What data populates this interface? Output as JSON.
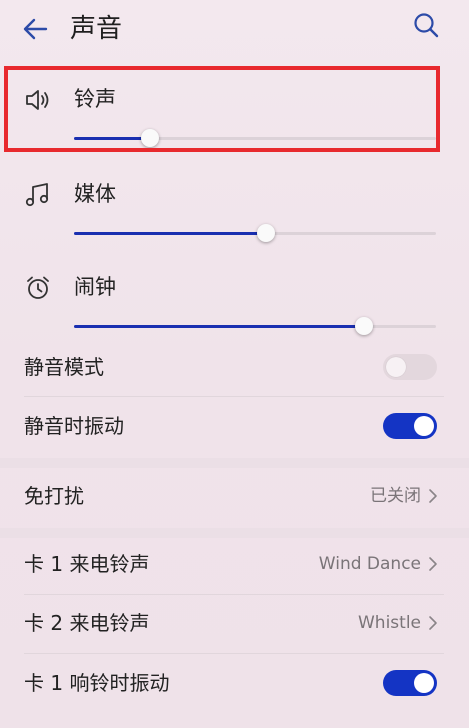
{
  "header": {
    "title": "声音",
    "back_icon": "arrow-left-icon",
    "search_icon": "search-icon"
  },
  "volume": {
    "ringtone": {
      "label": "铃声",
      "icon": "speaker-icon",
      "level": 0.21
    },
    "media": {
      "label": "媒体",
      "icon": "music-note-icon",
      "level": 0.53
    },
    "alarm": {
      "label": "闹钟",
      "icon": "alarm-clock-icon",
      "level": 0.8
    }
  },
  "settings": {
    "mute_mode": {
      "label": "静音模式",
      "enabled": false
    },
    "vibrate_on_mute": {
      "label": "静音时振动",
      "enabled": true
    },
    "do_not_disturb": {
      "label": "免打扰",
      "value": "已关闭"
    },
    "sim1_ringtone": {
      "label": "卡 1 来电铃声",
      "value": "Wind Dance"
    },
    "sim2_ringtone": {
      "label": "卡 2 来电铃声",
      "value": "Whistle"
    },
    "sim1_vibrate_on_ring": {
      "label": "卡 1 响铃时振动",
      "enabled": true
    }
  },
  "colors": {
    "accent": "#1434c4",
    "slider_fill": "#1a2fb0",
    "highlight": "#e8292e",
    "background": "#f2e6ec"
  }
}
